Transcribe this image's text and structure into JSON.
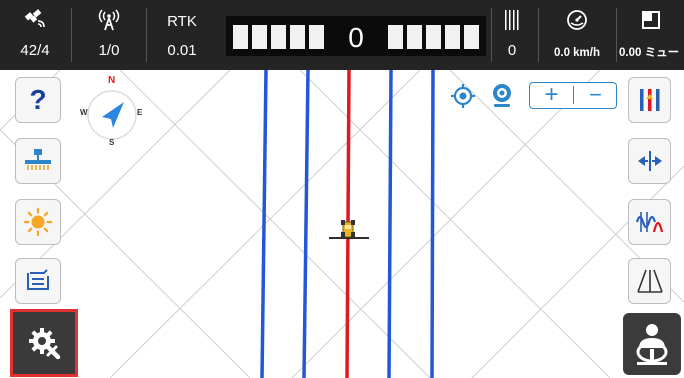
{
  "status_bar": {
    "satellites": {
      "icon": "satellite-icon",
      "value": "42/4"
    },
    "radio": {
      "icon": "antenna-signal-icon",
      "value": "1/0"
    },
    "rtk": {
      "label": "RTK",
      "value": "0.01"
    },
    "lightbar": {
      "value": "0",
      "left_segments": 5,
      "right_segments": 5
    },
    "row_count": {
      "icon": "row-lines-icon",
      "value": "0"
    },
    "speed": {
      "icon": "speedometer-icon",
      "value": "0.0 km/h"
    },
    "area": {
      "icon": "field-area-icon",
      "value": "0.00 ミュー"
    }
  },
  "left_toolbar": [
    {
      "name": "help-button",
      "icon": "question-mark-icon",
      "label": "?"
    },
    {
      "name": "implement-button",
      "icon": "tractor-implement-icon"
    },
    {
      "name": "brightness-button",
      "icon": "sun-icon"
    },
    {
      "name": "switch-line-button",
      "icon": "swap-lines-icon"
    },
    {
      "name": "settings-button",
      "icon": "gear-tools-icon",
      "selected": true
    }
  ],
  "right_toolbar": [
    {
      "name": "guidance-lines-button",
      "icon": "parallel-lines-icon"
    },
    {
      "name": "line-shift-button",
      "icon": "shift-arrows-icon"
    },
    {
      "name": "steering-gain-button",
      "icon": "wave-tuning-icon"
    },
    {
      "name": "perspective-view-button",
      "icon": "road-perspective-icon"
    },
    {
      "name": "auto-steer-button",
      "icon": "driver-wheel-icon"
    }
  ],
  "map_controls": {
    "locate": "locate-target-icon",
    "camera": "camera-follow-icon",
    "zoom_in": "+",
    "zoom_out": "−"
  },
  "compass": {
    "n": "N",
    "e": "E",
    "s": "S",
    "w": "W"
  },
  "colors": {
    "status_bar_bg": "#242424",
    "guide_line": "#2457d6",
    "active_line": "#e0181f",
    "accent": "#2d86c9",
    "selected_border": "#e13232"
  }
}
